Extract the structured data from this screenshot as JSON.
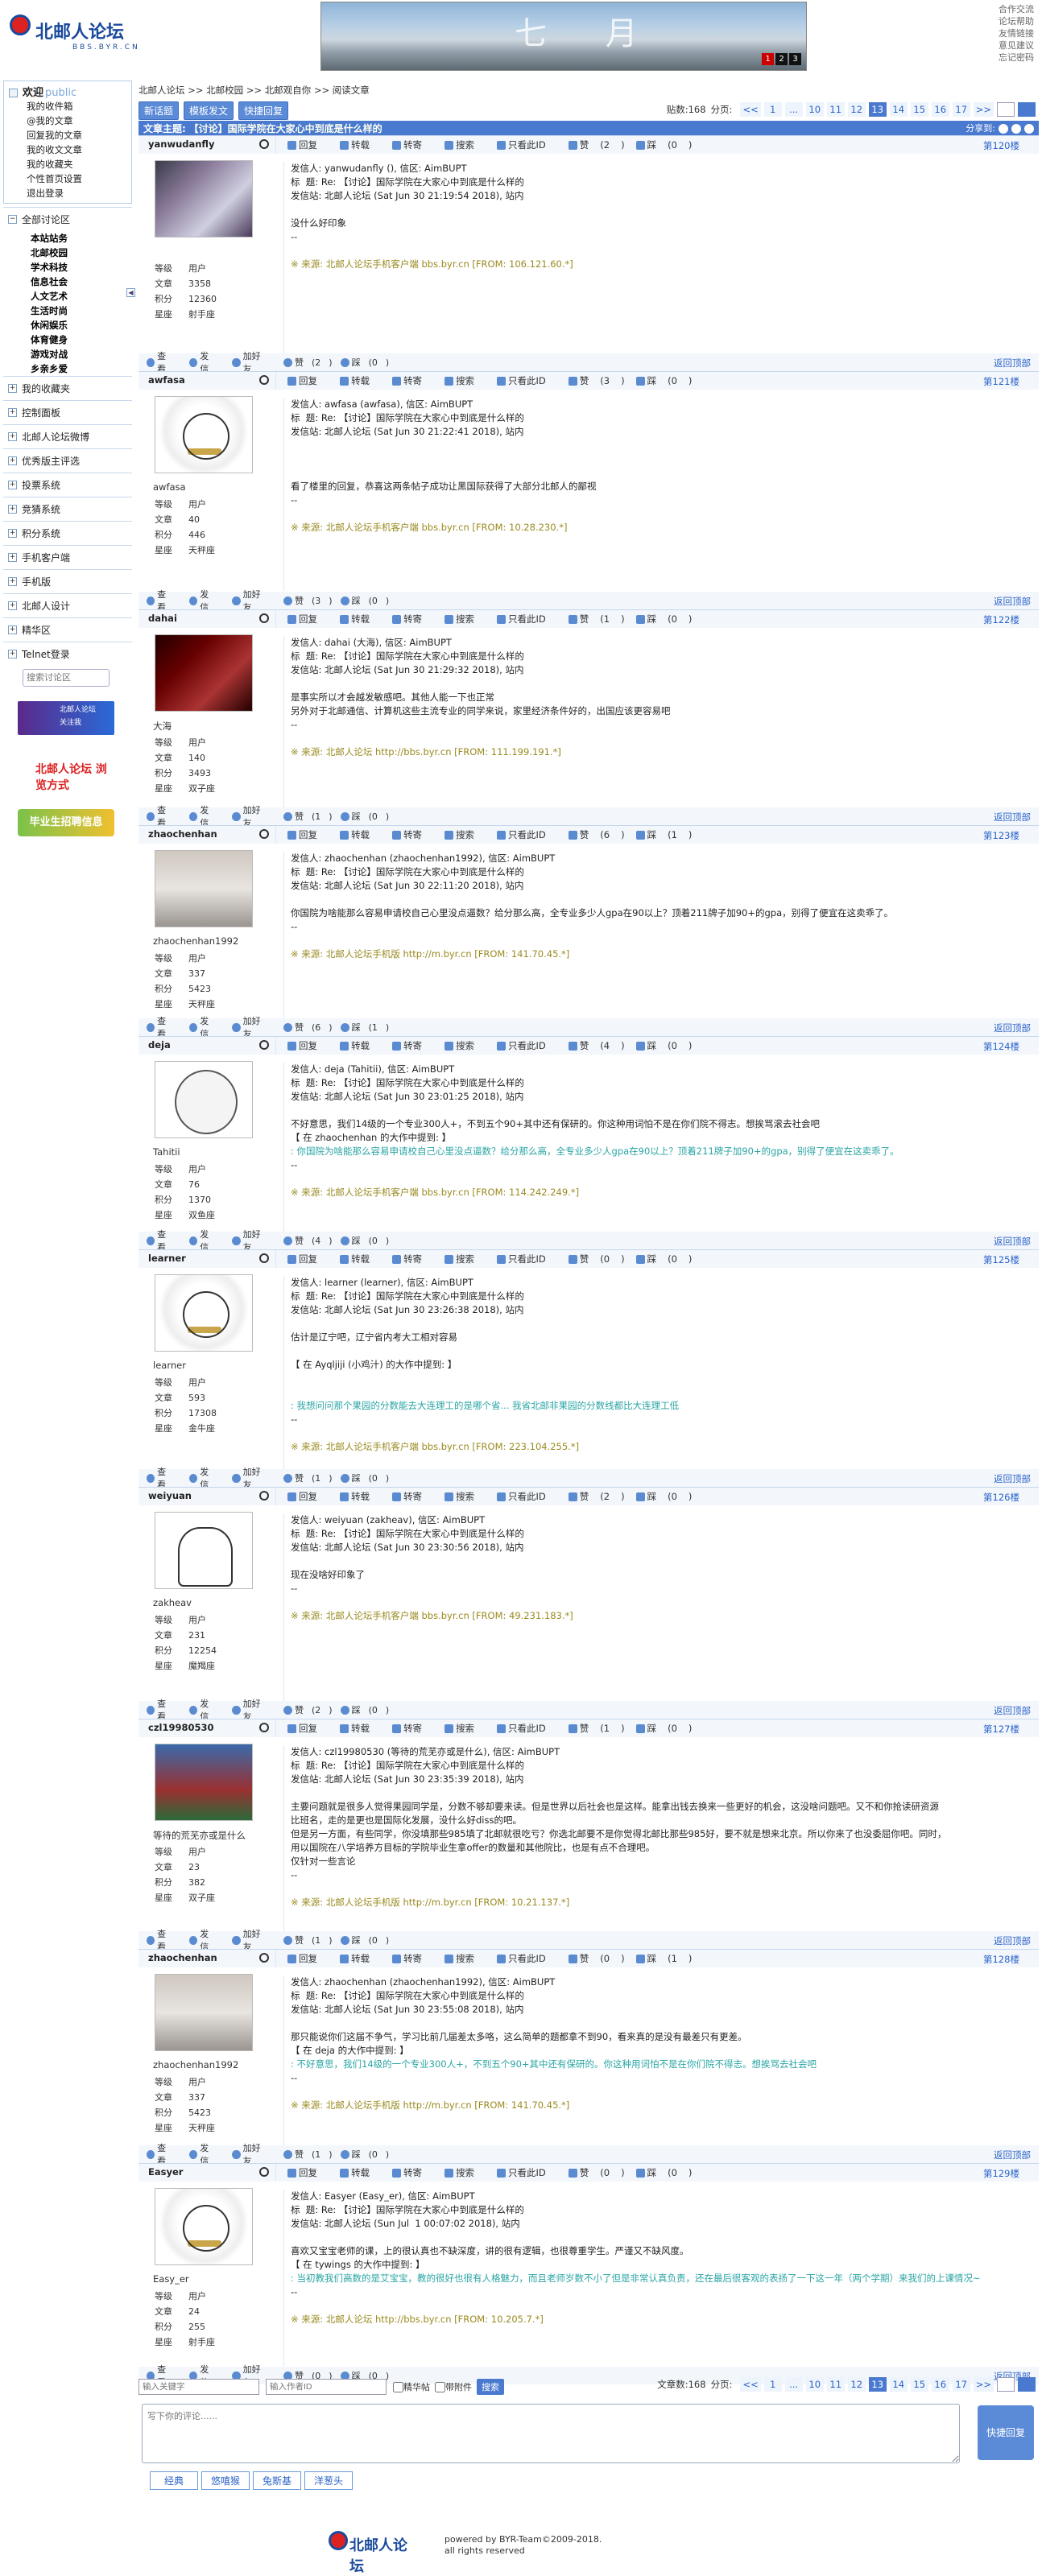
{
  "site": {
    "logo_text": "北邮人论坛",
    "logo_sub": "BBS.BYR.CN",
    "banner_text": "七 月",
    "banner_pages": [
      "1",
      "2",
      "3"
    ],
    "top_links": [
      "合作交流",
      "论坛帮助",
      "友情链接",
      "意见建议",
      "忘记密码"
    ]
  },
  "sidebar": {
    "welcome": "欢迎",
    "public": "public",
    "user_links": [
      "我的收件箱",
      "@我的文章",
      "回复我的文章",
      "我的收文文章",
      "我的收藏夹",
      "个性首页设置",
      "退出登录"
    ],
    "collapse": "◀",
    "sections": [
      {
        "label": "全部讨论区",
        "sub": [
          "本站站务",
          "北邮校园",
          "学术科技",
          "信息社会",
          "人文艺术",
          "生活时尚",
          "休闲娱乐",
          "体育健身",
          "游戏对战",
          "乡亲乡爱"
        ]
      },
      {
        "label": "我的收藏夹"
      },
      {
        "label": "控制面板"
      },
      {
        "label": "北邮人论坛微博"
      },
      {
        "label": "优秀版主评选"
      },
      {
        "label": "投票系统"
      },
      {
        "label": "竞猜系统"
      },
      {
        "label": "积分系统"
      },
      {
        "label": "手机客户端"
      },
      {
        "label": "手机版"
      },
      {
        "label": "北邮人设计"
      },
      {
        "label": "精华区"
      },
      {
        "label": "Telnet登录"
      }
    ],
    "search_placeholder": "搜索讨论区",
    "img1": "北邮人论坛",
    "img1_sub": "关注我",
    "img2": "北邮人论坛 浏览方式",
    "img3": "毕业生招聘信息"
  },
  "crumbs": [
    "北邮人论坛",
    ">>",
    "北邮校园",
    ">>",
    "北邮观自你",
    ">>",
    "阅读文章"
  ],
  "toolbar": {
    "new_post": "新话题",
    "mod_post": "模板发文",
    "quick_reply": "快捷回复"
  },
  "pager": {
    "label": "贴数:168",
    "label2": "文章数:168",
    "pages_label": "分页:",
    "prev": "<<",
    "pages": [
      "1",
      "...",
      "10",
      "11",
      "12",
      "13",
      "14",
      "15",
      "16",
      "17"
    ],
    "current": "13",
    "next": ">>"
  },
  "topic": {
    "label": "文章主题:",
    "title": "【讨论】国际学院在大家心中到底是什么样的",
    "share": "分享到:"
  },
  "actions": {
    "reply": "回复",
    "forward": "转载",
    "transfer": "转寄",
    "search": "搜索",
    "only": "只看此ID",
    "like": "赞",
    "dislike": "踩",
    "view": "查看",
    "send": "发信",
    "friend": "加好友",
    "back_top": "返回顶部"
  },
  "stat_labels": [
    "等级",
    "文章",
    "积分",
    "星座"
  ],
  "posts": [
    {
      "user": "yanwudanfly",
      "nick": "",
      "level": "用户",
      "articles": "3358",
      "score": "12360",
      "star": "射手座",
      "floor": "第120楼",
      "likes": "2",
      "dislikes": "0",
      "f_like": "2",
      "f_dis": "0",
      "avatar": "av-photo1",
      "lines": [
        "发信人: yanwudanfly (), 信区: AimBUPT",
        "标  题: Re: 【讨论】国际学院在大家心中到底是什么样的",
        "发信站: 北邮人论坛 (Sat Jun 30 21:19:54 2018), 站内",
        "",
        "没什么好印象",
        "--"
      ],
      "quote": [],
      "from": "※ 来源: 北邮人论坛手机客户端 bbs.byr.cn [FROM: 106.121.60.*]"
    },
    {
      "user": "awfasa",
      "nick": "awfasa",
      "level": "用户",
      "articles": "40",
      "score": "446",
      "star": "天秤座",
      "floor": "第121楼",
      "likes": "3",
      "dislikes": "0",
      "f_like": "3",
      "f_dis": "0",
      "avatar": "av-bear",
      "lines": [
        "发信人: awfasa (awfasa), 信区: AimBUPT",
        "标  题: Re: 【讨论】国际学院在大家心中到底是什么样的",
        "发信站: 北邮人论坛 (Sat Jun 30 21:22:41 2018), 站内",
        "",
        "",
        "",
        "看了楼里的回复，恭喜这两条帖子成功让黑国际获得了大部分北邮人的鄙视",
        "--"
      ],
      "quote": [],
      "from": "※ 来源: 北邮人论坛手机客户端 bbs.byr.cn [FROM: 10.28.230.*]"
    },
    {
      "user": "dahai",
      "nick": "大海",
      "level": "用户",
      "articles": "140",
      "score": "3493",
      "star": "双子座",
      "floor": "第122楼",
      "likes": "1",
      "dislikes": "0",
      "f_like": "1",
      "f_dis": "0",
      "avatar": "av-dark",
      "lines": [
        "发信人: dahai (大海), 信区: AimBUPT",
        "标  题: Re: 【讨论】国际学院在大家心中到底是什么样的",
        "发信站: 北邮人论坛 (Sat Jun 30 21:29:32 2018), 站内",
        "",
        "是事实所以才会越发敏感吧。其他人能一下也正常",
        "另外对于北邮通信、计算机这些主流专业的同学来说，家里经济条件好的，出国应该更容易吧",
        "--"
      ],
      "quote": [],
      "from": "※ 来源: 北邮人论坛 http://bbs.byr.cn [FROM: 111.199.191.*]"
    },
    {
      "user": "zhaochenhan",
      "nick": "zhaochenhan1992",
      "level": "用户",
      "articles": "337",
      "score": "5423",
      "star": "天秤座",
      "floor": "第123楼",
      "likes": "6",
      "dislikes": "1",
      "f_like": "6",
      "f_dis": "1",
      "avatar": "av-car",
      "lines": [
        "发信人: zhaochenhan (zhaochenhan1992), 信区: AimBUPT",
        "标  题: Re: 【讨论】国际学院在大家心中到底是什么样的",
        "发信站: 北邮人论坛 (Sat Jun 30 22:11:20 2018), 站内",
        "",
        "你国院为啥能那么容易申请校自己心里没点逼数？给分那么高，全专业多少人gpa在90以上？顶着211牌子加90+的gpa，别得了便宜在这卖乖了。",
        "--"
      ],
      "quote": [],
      "from": "※ 来源: 北邮人论坛手机版 http://m.byr.cn [FROM: 141.70.45.*]"
    },
    {
      "user": "deja",
      "nick": "Tahitii",
      "level": "用户",
      "articles": "76",
      "score": "1370",
      "star": "双鱼座",
      "floor": "第124楼",
      "likes": "4",
      "dislikes": "0",
      "f_like": "4",
      "f_dis": "0",
      "avatar": "av-polar",
      "lines": [
        "发信人: deja (Tahitii), 信区: AimBUPT",
        "标  题: Re: 【讨论】国际学院在大家心中到底是什么样的",
        "发信站: 北邮人论坛 (Sat Jun 30 23:01:25 2018), 站内",
        "",
        "不好意思，我们14级的一个专业300人+，不到五个90+其中还有保研的。你这种用词怕不是在你们院不得志。想挨骂滚去社会吧",
        "【 在 zhaochenhan 的大作中提到: 】"
      ],
      "quote": [
        ": 你国院为啥能那么容易申请校自己心里没点逼数？给分那么高，全专业多少人gpa在90以上？顶着211牌子加90+的gpa，别得了便宜在这卖乖了。"
      ],
      "tail": [
        "--"
      ],
      "from": "※ 来源: 北邮人论坛手机客户端 bbs.byr.cn [FROM: 114.242.249.*]"
    },
    {
      "user": "learner",
      "nick": "learner",
      "level": "用户",
      "articles": "593",
      "score": "17308",
      "star": "金牛座",
      "floor": "第125楼",
      "likes": "0",
      "dislikes": "0",
      "f_like": "1",
      "f_dis": "0",
      "avatar": "av-bear",
      "lines": [
        "发信人: learner (learner), 信区: AimBUPT",
        "标  题: Re: 【讨论】国际学院在大家心中到底是什么样的",
        "发信站: 北邮人论坛 (Sat Jun 30 23:26:38 2018), 站内",
        "",
        "估计是辽宁吧，辽宁省内考大工相对容易",
        "",
        "【 在 Ayqljiji (小鸡汁) 的大作中提到: 】",
        "",
        ""
      ],
      "quote": [
        ": 我想问问那个果园的分数能去大连理工的是哪个省... 我省北邮非果园的分数线都比大连理工低"
      ],
      "tail": [
        "--",
        "",
        "※ 来源: 北邮人论坛手机客户端 bbs.byr.cn [FROM: 223.104.255.*]"
      ],
      "from": ""
    },
    {
      "user": "weiyuan",
      "nick": "zakheav",
      "level": "用户",
      "articles": "231",
      "score": "12254",
      "star": "魔羯座",
      "floor": "第126楼",
      "likes": "2",
      "dislikes": "0",
      "f_like": "2",
      "f_dis": "0",
      "avatar": "av-ghost",
      "lines": [
        "发信人: weiyuan (zakheav), 信区: AimBUPT",
        "标  题: Re: 【讨论】国际学院在大家心中到底是什么样的",
        "发信站: 北邮人论坛 (Sat Jun 30 23:30:56 2018), 站内",
        "",
        "现在没啥好印象了",
        "--"
      ],
      "quote": [],
      "from": "※ 来源: 北邮人论坛手机客户端 bbs.byr.cn [FROM: 49.231.183.*]"
    },
    {
      "user": "czl19980530",
      "nick": "等待的荒芜亦或是什么",
      "level": "用户",
      "articles": "23",
      "score": "382",
      "star": "双子座",
      "floor": "第127楼",
      "likes": "1",
      "dislikes": "0",
      "f_like": "1",
      "f_dis": "0",
      "avatar": "av-wall",
      "lines": [
        "发信人: czl19980530 (等待的荒芜亦或是什么), 信区: AimBUPT",
        "标  题: Re: 【讨论】国际学院在大家心中到底是什么样的",
        "发信站: 北邮人论坛 (Sat Jun 30 23:35:39 2018), 站内",
        "",
        "主要问题就是很多人觉得果园同学是，分数不够却要来读。但是世界以后社会也是这样。能拿出钱去换来一些更好的机会，这没啥问题吧。又不和你抢读研资源",
        "比班名，走的是更也是国际化发展，没什么好diss的吧。",
        "但是另一方面，有些同学，你没填那些985填了北邮就很吃亏？你选北邮要不是你觉得北邮比那些985好，要不就是想来北京。所以你来了也没委屈你吧。同时，",
        "用以国院在八学培养方目标的学院毕业生拿offer的数量和其他院比，也是有点不合理吧。",
        "仅针对一些言论",
        "--"
      ],
      "quote": [],
      "from": "※ 来源: 北邮人论坛手机版 http://m.byr.cn [FROM: 10.21.137.*]"
    },
    {
      "user": "zhaochenhan",
      "nick": "zhaochenhan1992",
      "level": "用户",
      "articles": "337",
      "score": "5423",
      "star": "天秤座",
      "floor": "第128楼",
      "likes": "0",
      "dislikes": "1",
      "f_like": "1",
      "f_dis": "0",
      "avatar": "av-car",
      "lines": [
        "发信人: zhaochenhan (zhaochenhan1992), 信区: AimBUPT",
        "标  题: Re: 【讨论】国际学院在大家心中到底是什么样的",
        "发信站: 北邮人论坛 (Sat Jun 30 23:55:08 2018), 站内",
        "",
        "那只能说你们这届不争气，学习比前几届差太多咯，这么简单的题都拿不到90，看来真的是没有最差只有更差。",
        "【 在 deja 的大作中提到: 】"
      ],
      "quote": [
        ": 不好意思，我们14级的一个专业300人+，不到五个90+其中还有保研的。你这种用词怕不是在你们院不得志。想挨骂去社会吧"
      ],
      "tail": [
        "--"
      ],
      "from": "※ 来源: 北邮人论坛手机版 http://m.byr.cn [FROM: 141.70.45.*]"
    },
    {
      "user": "Easyer",
      "nick": "Easy_er",
      "level": "用户",
      "articles": "24",
      "score": "255",
      "star": "射手座",
      "floor": "第129楼",
      "likes": "0",
      "dislikes": "0",
      "f_like": "0",
      "f_dis": "0",
      "avatar": "av-bear",
      "lines": [
        "发信人: Easyer (Easy_er), 信区: AimBUPT",
        "标  题: Re: 【讨论】国际学院在大家心中到底是什么样的",
        "发信站: 北邮人论坛 (Sun Jul  1 00:07:02 2018), 站内",
        "",
        "喜欢又宝宝老师的课，上的很认真也不缺深度，讲的很有逻辑，也很尊重学生。严谨又不缺风度。",
        "【 在 tywings 的大作中提到: 】"
      ],
      "quote": [
        ": 当初教我们高数的是艾宝宝，教的很好也很有人格魅力，而且老师岁数不小了但是非常认真负责，还在最后很客观的表扬了一下这一年（两个学期）来我们的上课情况~"
      ],
      "tail": [
        "--"
      ],
      "from": "※ 来源: 北邮人论坛 http://bbs.byr.cn [FROM: 10.205.7.*]"
    }
  ],
  "bottom": {
    "kw_placeholder": "输入关键字",
    "id_placeholder": "输入作者ID",
    "digest": "精华帖",
    "attach": "带附件",
    "search_btn": "搜索",
    "reply_placeholder": "写下你的评论......",
    "quick_reply": "快捷回复",
    "tabs": [
      "经典",
      "悠嘻猴",
      "兔斯基",
      "洋葱头"
    ]
  },
  "footer": {
    "logo": "北邮人论坛",
    "line1": "powered by BYR-Team©2009-2018.",
    "line2": "all rights reserved"
  }
}
